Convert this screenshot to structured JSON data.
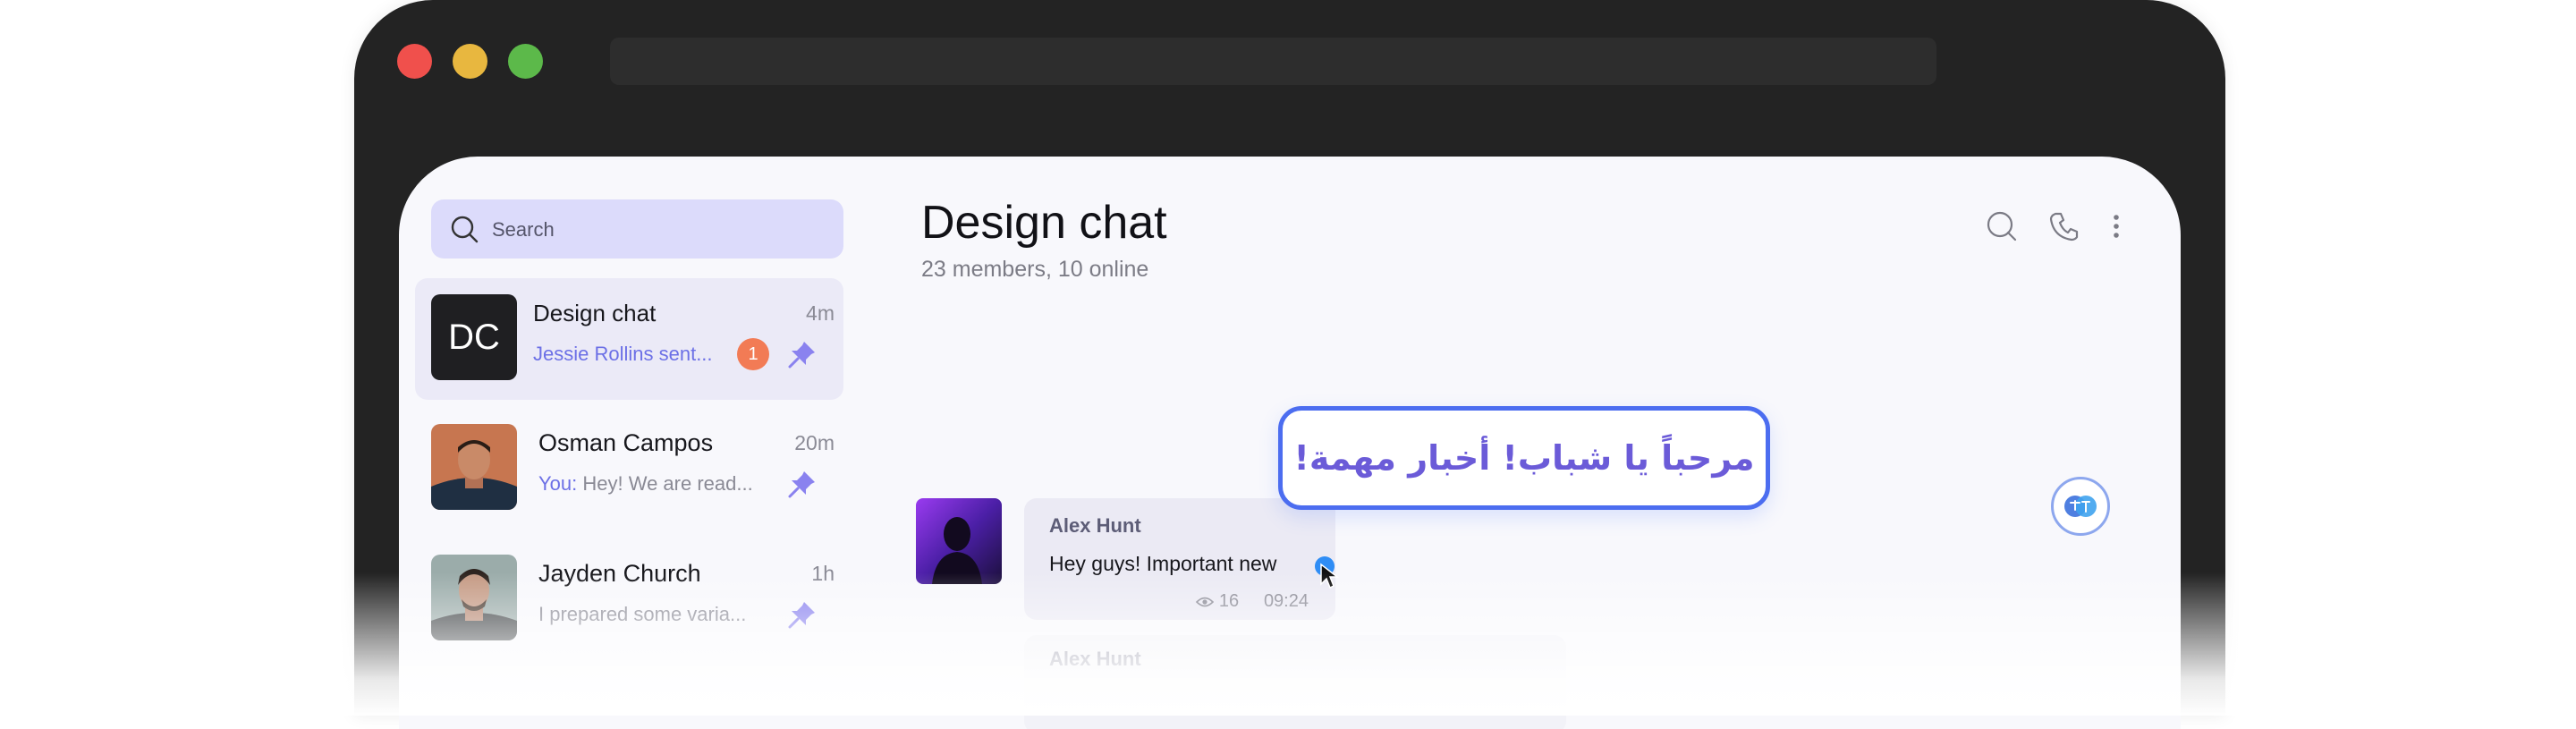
{
  "search": {
    "placeholder": "Search"
  },
  "chats": [
    {
      "avatar_initials": "DC",
      "title": "Design chat",
      "time": "4m",
      "preview": "Jessie Rollins sent...",
      "badge": "1"
    },
    {
      "title": "Osman Campos",
      "time": "20m",
      "preview_prefix": "You:",
      "preview": " Hey! We are read..."
    },
    {
      "title": "Jayden Church",
      "time": "1h",
      "preview": "I prepared some varia..."
    }
  ],
  "header": {
    "title": "Design chat",
    "subtitle": "23 members, 10 online"
  },
  "message": {
    "author": "Alex Hunt",
    "text": "Hey guys! Important new",
    "views": "16",
    "time": "09:24"
  },
  "message2": {
    "author": "Alex Hunt"
  },
  "translation": {
    "text": "مرحباً يا شباب! أخبار مهمة!"
  },
  "colors": {
    "accent": "#6c70e6",
    "badge": "#f27b55",
    "popup_border": "#4c6df0"
  }
}
